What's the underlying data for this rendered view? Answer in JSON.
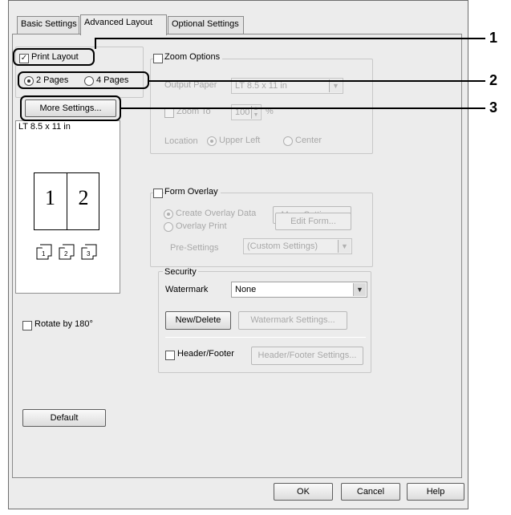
{
  "tabs": [
    {
      "label": "Basic Settings",
      "active": false
    },
    {
      "label": "Advanced Layout",
      "active": true
    },
    {
      "label": "Optional Settings",
      "active": false
    }
  ],
  "layout": {
    "print_layout_label": "Print Layout",
    "print_layout_checked": true,
    "pages_2_label": "2 Pages",
    "pages_4_label": "4 Pages",
    "more_settings_label": "More Settings...",
    "preview_paper": "LT 8.5 x 11 in",
    "page_num_1": "1",
    "page_num_2": "2",
    "rotate_label": "Rotate by 180°",
    "default_label": "Default"
  },
  "zoom": {
    "label": "Zoom Options",
    "output_paper_label": "Output Paper",
    "output_paper_value": "LT 8.5 x 11 in",
    "zoom_to_label": "Zoom To",
    "zoom_value": "100",
    "zoom_unit": "%",
    "location_label": "Location",
    "upper_left_label": "Upper Left",
    "center_label": "Center"
  },
  "overlay": {
    "label": "Form Overlay",
    "create_label": "Create Overlay Data",
    "more_settings_label": "More Settings...",
    "overlay_print_label": "Overlay Print",
    "edit_form_label": "Edit Form...",
    "presettings_label": "Pre-Settings",
    "presettings_value": "(Custom Settings)"
  },
  "security": {
    "label": "Security",
    "watermark_label": "Watermark",
    "watermark_value": "None",
    "new_delete_label": "New/Delete",
    "watermark_settings_label": "Watermark Settings...",
    "header_footer_label": "Header/Footer",
    "header_footer_settings_label": "Header/Footer Settings..."
  },
  "footer": {
    "ok": "OK",
    "cancel": "Cancel",
    "help": "Help"
  },
  "callouts": [
    "1",
    "2",
    "3"
  ]
}
